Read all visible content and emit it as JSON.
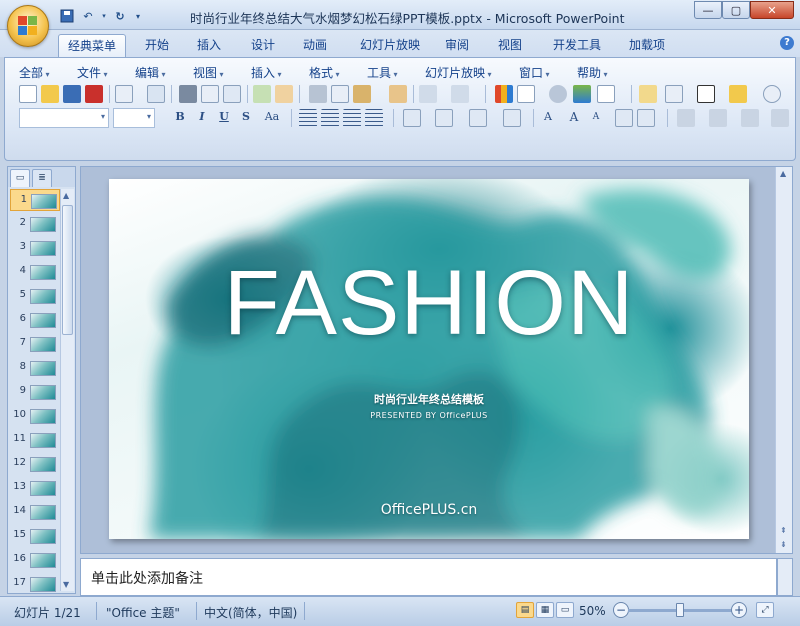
{
  "window": {
    "title": "时尚行业年终总结大气水烟梦幻松石绿PPT模板.pptx - Microsoft PowerPoint"
  },
  "ribbon_tabs": [
    {
      "label": "经典菜单",
      "active": true
    },
    {
      "label": "开始"
    },
    {
      "label": "插入"
    },
    {
      "label": "设计"
    },
    {
      "label": "动画"
    },
    {
      "label": "幻灯片放映"
    },
    {
      "label": "审阅"
    },
    {
      "label": "视图"
    },
    {
      "label": "开发工具"
    },
    {
      "label": "加载项"
    }
  ],
  "menus": [
    "全部",
    "文件",
    "编辑",
    "视图",
    "插入",
    "格式",
    "工具",
    "幻灯片放映",
    "窗口",
    "帮助"
  ],
  "format_buttons": {
    "bold": "B",
    "italic": "I",
    "underline": "U",
    "shadow": "S",
    "change_case": "Aa",
    "font_color": "A"
  },
  "thumbnails": [
    "1",
    "2",
    "3",
    "4",
    "5",
    "6",
    "7",
    "8",
    "9",
    "10",
    "11",
    "12",
    "13",
    "14",
    "15",
    "16",
    "17"
  ],
  "selected_slide": 1,
  "slide": {
    "title": "FASHION",
    "subtitle": "时尚行业年终总结模板",
    "presented_by": "PRESENTED  BY OfficePLUS",
    "brand": "OfficePLUS.cn"
  },
  "notes": {
    "placeholder": "单击此处添加备注"
  },
  "status": {
    "slide_counter": "幻灯片 1/21",
    "theme": "\"Office 主题\"",
    "language": "中文(简体，中国)",
    "zoom": "50%",
    "zoom_fraction": 0.5
  },
  "colors": {
    "accent": "#15428b",
    "slide_teal": "#1f8e99"
  }
}
